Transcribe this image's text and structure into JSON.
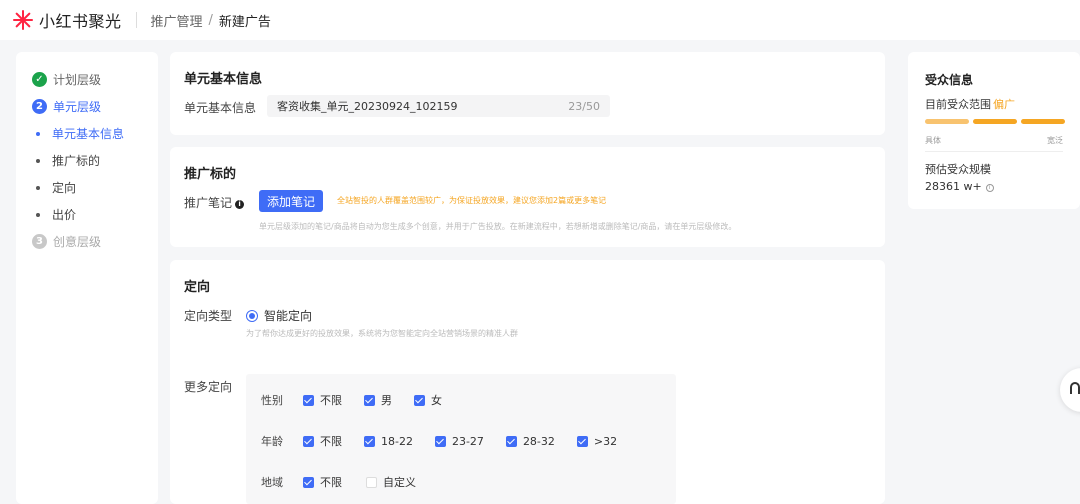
{
  "brand": {
    "name": "小红书聚光",
    "accent": "#ff2442"
  },
  "breadcrumb": {
    "parent": "推广管理",
    "separator": "/",
    "current": "新建广告"
  },
  "sidebar": {
    "steps": [
      {
        "label": "计划层级",
        "num": "✓",
        "state": "done"
      },
      {
        "label": "单元层级",
        "num": "2",
        "state": "active"
      }
    ],
    "sub_items": [
      "单元基本信息",
      "推广标的",
      "定向",
      "出价"
    ],
    "step3": {
      "label": "创意层级",
      "num": "3"
    }
  },
  "unit_info": {
    "title": "单元基本信息",
    "field_label": "单元基本信息",
    "value": "客资收集_单元_20230924_102159",
    "count": "23/50"
  },
  "promotion": {
    "title": "推广标的",
    "field_label": "推广笔记",
    "info_icon": "i",
    "add_button": "添加笔记",
    "warning": "全站智投的人群覆盖范围较广，为保证投放效果，建议您添加2篇或更多笔记",
    "hint": "单元层级添加的笔记/商品将自动为您生成多个创意，并用于广告投放。在新建流程中，若想新增或删除笔记/商品，请在单元层级修改。"
  },
  "targeting": {
    "title": "定向",
    "type_label": "定向类型",
    "type_value": "智能定向",
    "type_hint": "为了帮你达成更好的投放效果，系统将为您智能定向全站营销场景的精准人群",
    "more_label": "更多定向",
    "gender": {
      "label": "性别",
      "options": [
        "不限",
        "男",
        "女"
      ]
    },
    "age": {
      "label": "年龄",
      "options": [
        "不限",
        "18-22",
        "23-27",
        "28-32",
        ">32"
      ]
    },
    "region": {
      "label": "地域",
      "opt_unlimited": "不限",
      "opt_custom": "自定义"
    }
  },
  "audience": {
    "title": "受众信息",
    "range_label": "目前受众范围",
    "range_value": "偏广",
    "scale_left": "具体",
    "scale_right": "宽泛",
    "estimate_label": "预估受众规模",
    "estimate_value": "28361 w+",
    "help_icon": "i"
  },
  "colors": {
    "primary": "#3f6cf6",
    "warning": "#f5a623",
    "success": "#1ba34b"
  }
}
